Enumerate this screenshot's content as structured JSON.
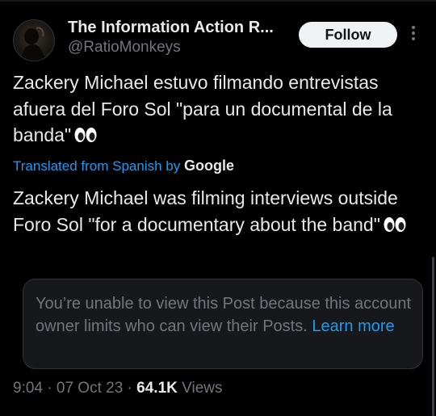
{
  "author": {
    "display_name": "The Information Action R...",
    "handle": "@RatioMonkeys"
  },
  "follow_label": "Follow",
  "icons": {
    "more": "more-options-icon",
    "eyes": "eyes-emoji-icon",
    "avatar": "profile-avatar"
  },
  "post": {
    "original_text": "Zackery Michael estuvo filmando entrevistas afuera del Foro Sol \"para un documental de la banda\"",
    "translation_prefix": "Translated from Spanish by",
    "translation_provider": "Google",
    "translated_text": "Zackery Michael was filming interviews outside Foro Sol \"for a documentary about the band\""
  },
  "restricted_notice": {
    "message": "You’re unable to view this Post because this account owner limits who can view their Posts.",
    "link_label": "Learn more"
  },
  "meta": {
    "time": "9:04",
    "sep1": " · ",
    "date": "07 Oct 23",
    "sep2": " · ",
    "views_count": "64.1K",
    "views_label": "Views"
  },
  "colors": {
    "background": "#000000",
    "text": "#e7e9ea",
    "secondary": "#71767b",
    "link": "#1d9bf0",
    "card": "#16181c",
    "border": "#2f3336"
  }
}
